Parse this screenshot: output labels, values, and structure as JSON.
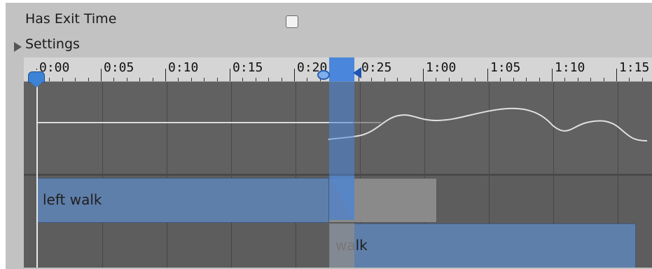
{
  "settings_panel": {
    "has_exit_time_label": "Has Exit Time",
    "has_exit_time_checked": false,
    "settings_label": "Settings"
  },
  "timeline": {
    "ruler_labels": [
      "0:00",
      "0:05",
      "0:10",
      "0:15",
      "0:20",
      "0:25",
      "1:00",
      "1:05",
      "1:10",
      "1:15"
    ],
    "clips": [
      {
        "name": "left walk"
      },
      {
        "name": "walk"
      }
    ]
  },
  "colors": {
    "panel_bg": "#c2c2c2",
    "curve_bg": "#616161",
    "track_bg": "#5d5d5d",
    "clip_blue": "#5f7fab",
    "clip_gray": "#8a8a8a",
    "accent": "#3c83d6"
  }
}
